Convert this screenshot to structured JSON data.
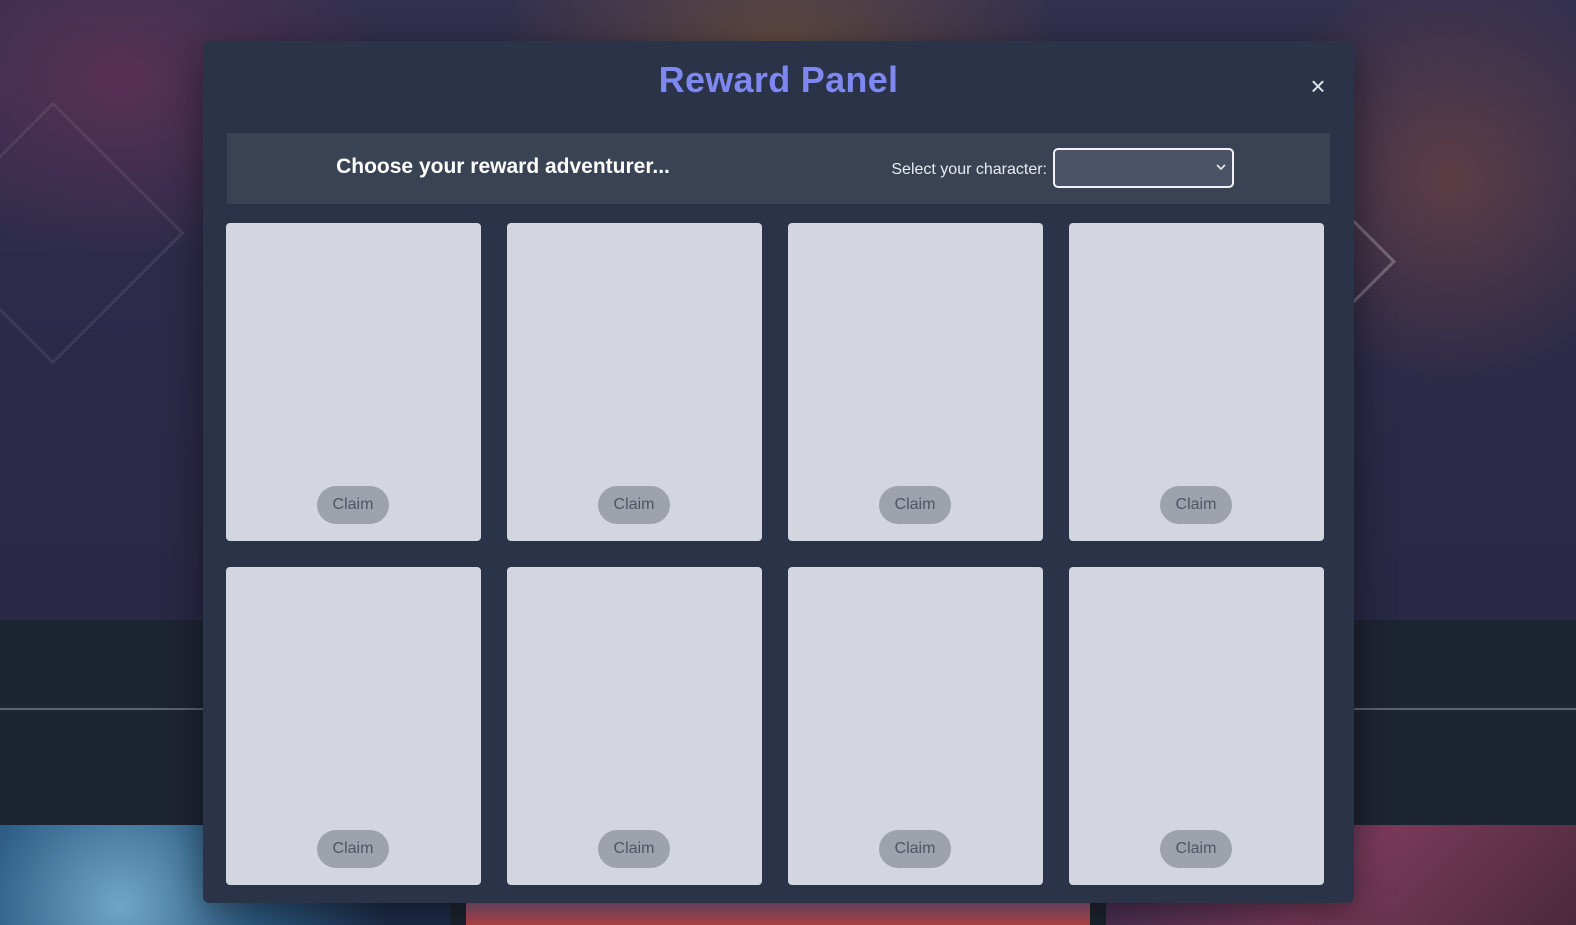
{
  "modal": {
    "title": "Reward Panel",
    "close_label": "×"
  },
  "toolbar": {
    "heading": "Choose your reward adventurer...",
    "select_label": "Select your character:",
    "select_value": ""
  },
  "rewards": [
    {
      "claim_label": "Claim"
    },
    {
      "claim_label": "Claim"
    },
    {
      "claim_label": "Claim"
    },
    {
      "claim_label": "Claim"
    },
    {
      "claim_label": "Claim"
    },
    {
      "claim_label": "Claim"
    },
    {
      "claim_label": "Claim"
    },
    {
      "claim_label": "Claim"
    }
  ],
  "colors": {
    "accent": "#7f88f0",
    "modal_bg": "#2a3347",
    "card_bg": "#d3d6de",
    "claim_button_bg": "#9da2ad"
  }
}
